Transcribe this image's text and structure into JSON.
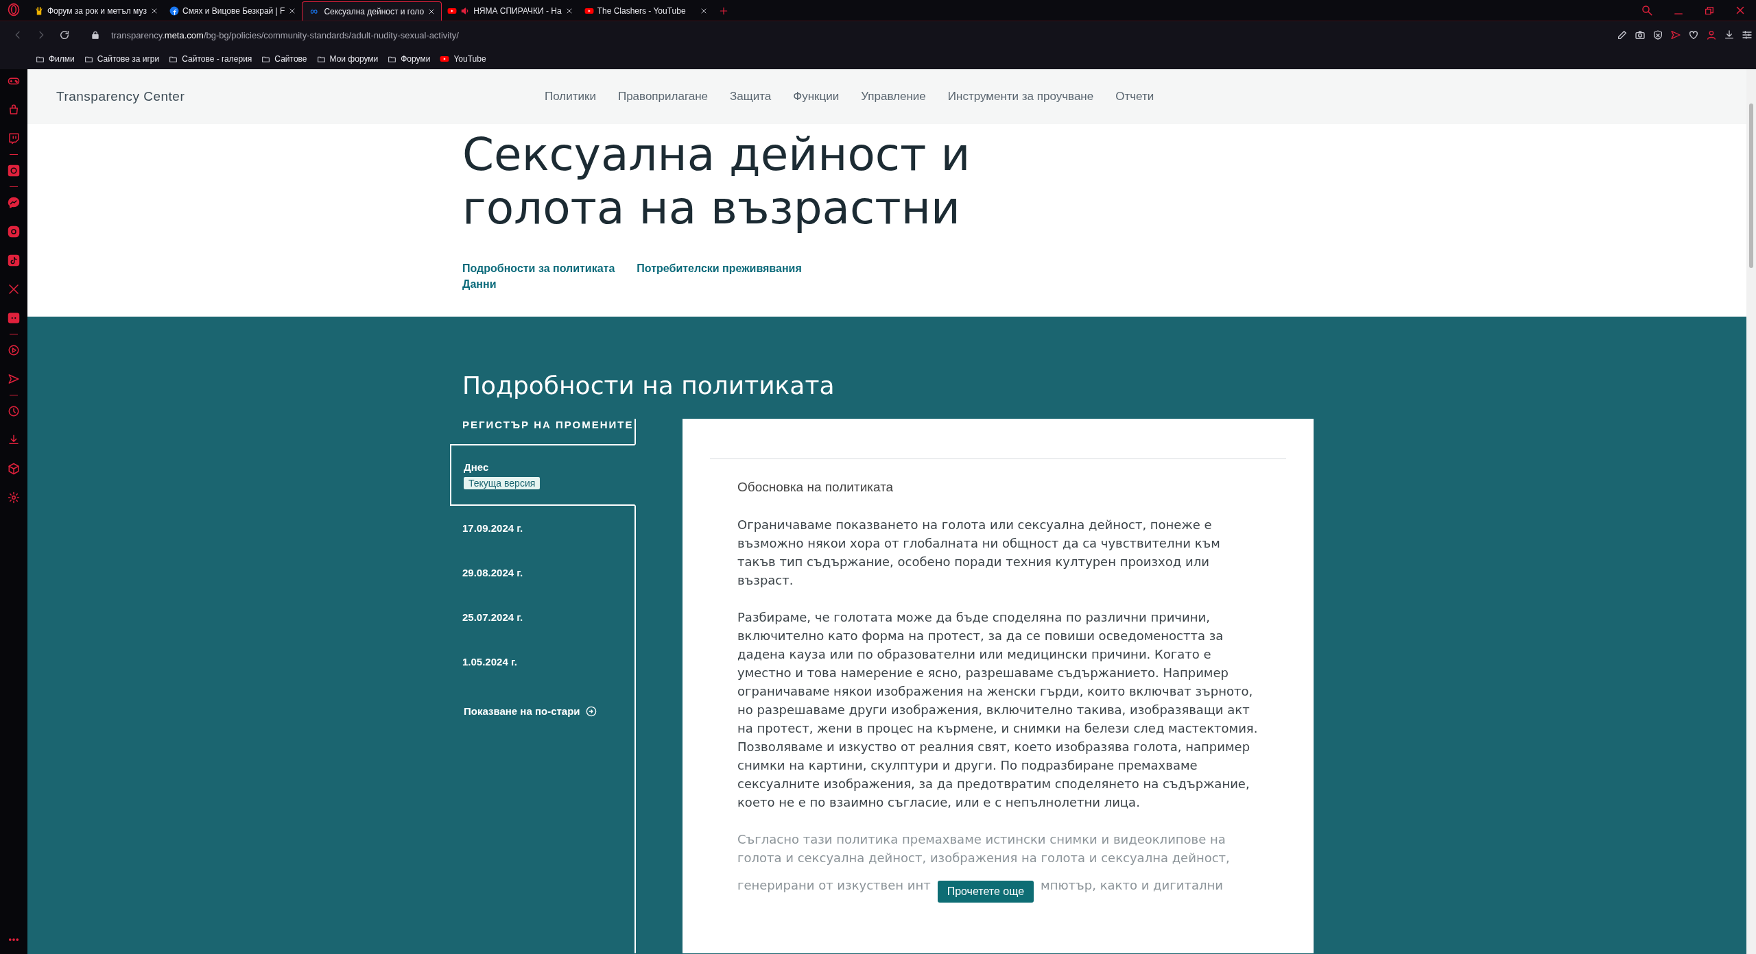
{
  "browser": {
    "tabs": [
      {
        "title": "Форум за рок и метъл муз",
        "kind": "rock",
        "selected": false
      },
      {
        "title": "Смях и Вицове Безкрай | F",
        "kind": "facebook",
        "selected": false
      },
      {
        "title": "Сексуална дейност и голо",
        "kind": "meta",
        "selected": true
      },
      {
        "title": "НЯМА СПИРАЧКИ - На",
        "kind": "youtube-audio",
        "selected": false
      },
      {
        "title": "The Clashers - YouTube",
        "kind": "youtube",
        "selected": false
      }
    ],
    "address": "transparency.**meta.com**/bg-bg/policies/community-standards/adult-nudity-sexual-activity/",
    "bookmarks": [
      {
        "label": "Филми",
        "kind": "folder"
      },
      {
        "label": "Сайтове за игри",
        "kind": "folder"
      },
      {
        "label": "Сайтове - галерия",
        "kind": "folder"
      },
      {
        "label": "Сайтове",
        "kind": "folder"
      },
      {
        "label": "Мои форуми",
        "kind": "folder"
      },
      {
        "label": "Форуми",
        "kind": "folder"
      },
      {
        "label": "YouTube",
        "kind": "youtube"
      }
    ]
  },
  "page": {
    "brand": "Transparency Center",
    "nav": [
      "Политики",
      "Правоприлагане",
      "Защита",
      "Функции",
      "Управление",
      "Инструменти за проучване",
      "Отчети"
    ],
    "title": "Сексуална дейност и голота на възрастни",
    "anchors": [
      [
        "Подробности за политиката",
        "Потребителски преживявания"
      ],
      [
        "Данни"
      ]
    ],
    "section_title": "Подробности на политиката",
    "changelog": {
      "title": "РЕГИСТЪР НА ПРОМЕНИТЕ",
      "items": [
        {
          "date": "Днес",
          "badge": "Текуща версия",
          "selected": true
        },
        {
          "date": "17.09.2024 г.",
          "selected": false
        },
        {
          "date": "29.08.2024 г.",
          "selected": false
        },
        {
          "date": "25.07.2024 г.",
          "selected": false
        },
        {
          "date": "1.05.2024 г.",
          "selected": false
        }
      ],
      "show_older": "Показване на по-стари"
    },
    "card": {
      "heading": "Обосновка на политиката",
      "paragraphs": [
        "Ограничаваме показването на голота или сексуална дейност, понеже е възможно някои хора от глобалната ни общност да са чувствителни към такъв тип съдържание, особено поради техния културен произход или възраст.",
        "Разбираме, че голотата може да бъде споделяна по различни причини, включително като форма на протест, за да се повиши осведомеността за дадена кауза или по образователни или медицински причини. Когато е уместно и това намерение е ясно, разрешаваме съдържанието. Например ограничаваме някои изображения на женски гърди, които включват зърното, но разрешаваме други изображения, включително такива, изобразяващи акт на протест, жени в процес на кърмене, и снимки на белези след мастектомия. Позволяваме и изкуство от реалния свят, което изобразява голота, например снимки на картини, скулптури и други. По подразбиране премахваме сексуалните изображения, за да предотвратим споделянето на съдържание, което не е по взаимно съгласие, или е с непълнолетни лица."
      ],
      "faded": "Съгласно тази политика премахваме истински снимки и видеоклипове на голота и сексуална дейност, изображения на голота и сексуална дейност,",
      "faded_tail_left": "генерирани от изкуствен инт",
      "faded_tail_right": "мпютър, както и дигитални",
      "read_more": "Прочетете още"
    }
  }
}
